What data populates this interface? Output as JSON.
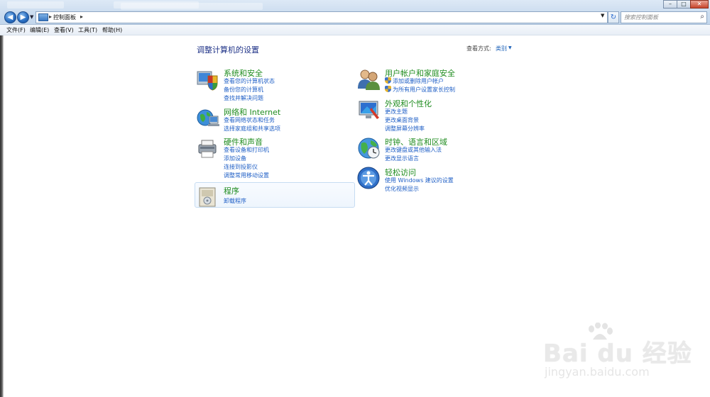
{
  "window": {
    "breadcrumb": "控制面板",
    "search_placeholder": "搜索控制面板"
  },
  "menu": [
    "文件(F)",
    "编辑(E)",
    "查看(V)",
    "工具(T)",
    "帮助(H)"
  ],
  "page": {
    "title": "调整计算机的设置",
    "view_by_label": "查看方式:",
    "view_by_value": "类别"
  },
  "categories_left": [
    {
      "title": "系统和安全",
      "icon": "system-security-icon",
      "links": [
        "查看您的计算机状态",
        "备份您的计算机",
        "查找并解决问题"
      ]
    },
    {
      "title": "网络和 Internet",
      "icon": "network-internet-icon",
      "links": [
        "查看网络状态和任务",
        "选择家庭组和共享选项"
      ]
    },
    {
      "title": "硬件和声音",
      "icon": "hardware-sound-icon",
      "links": [
        "查看设备和打印机",
        "添加设备",
        "连接到投影仪",
        "调整常用移动设置"
      ]
    },
    {
      "title": "程序",
      "icon": "programs-icon",
      "links": [
        "卸载程序"
      ]
    }
  ],
  "categories_right": [
    {
      "title": "用户帐户和家庭安全",
      "icon": "user-accounts-icon",
      "links": [
        "添加或删除用户帐户",
        "为所有用户设置家长控制"
      ]
    },
    {
      "title": "外观和个性化",
      "icon": "appearance-icon",
      "links": [
        "更改主题",
        "更改桌面背景",
        "调整屏幕分辨率"
      ]
    },
    {
      "title": "时钟、语言和区域",
      "icon": "clock-language-region-icon",
      "links": [
        "更改键盘或其他输入法",
        "更改显示语言"
      ]
    },
    {
      "title": "轻松访问",
      "icon": "ease-of-access-icon",
      "links": [
        "使用 Windows 建议的设置",
        "优化视频显示"
      ]
    }
  ],
  "watermark": {
    "brand": "Bai du 经验",
    "url": "jingyan.baidu.com"
  }
}
